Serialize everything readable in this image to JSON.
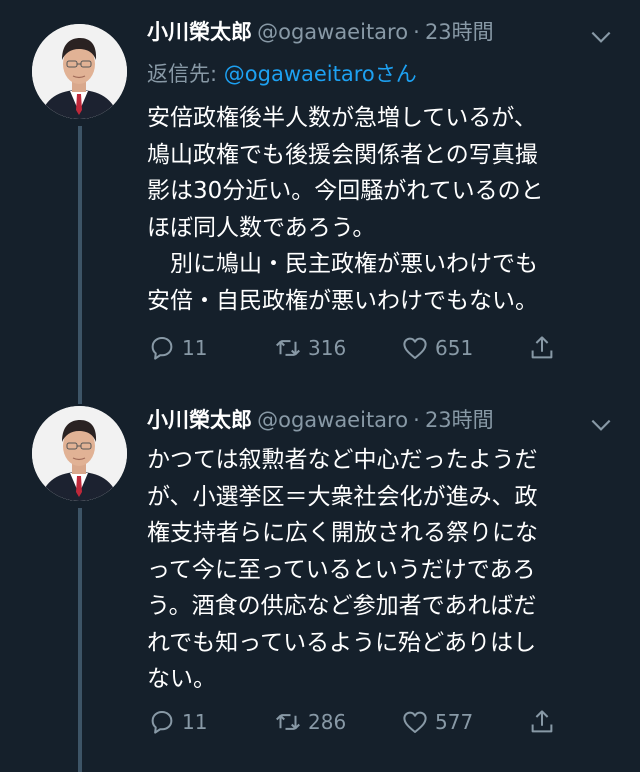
{
  "tweets": [
    {
      "author_name": "小川榮太郎",
      "handle": "@ogawaeitaro",
      "separator": "·",
      "time": "23時間",
      "reply_prefix": "返信先:",
      "reply_mention": "@ogawaeitaroさん",
      "lines": [
        "安倍政権後半人数が急増しているが、",
        "鳩山政権でも後援会関係者との写真撮",
        "影は30分近い。今回騒がれているのと",
        "ほぼ同人数であろう。",
        "　別に鳩山・民主政権が悪いわけでも",
        "安倍・自民政権が悪いわけでもない。"
      ],
      "replies": "11",
      "retweets": "316",
      "likes": "651"
    },
    {
      "author_name": "小川榮太郎",
      "handle": "@ogawaeitaro",
      "separator": "·",
      "time": "23時間",
      "lines": [
        "かつては叙勲者など中心だったようだ",
        "が、小選挙区＝大衆社会化が進み、政",
        "権支持者らに広く開放される祭りにな",
        "って今に至っているというだけであろ",
        "う。酒食の供応など参加者であればだ",
        "れでも知っているように殆どありはし",
        "ない。"
      ],
      "replies": "11",
      "retweets": "286",
      "likes": "577"
    }
  ],
  "icons": {
    "reply": "reply-icon",
    "retweet": "retweet-icon",
    "like": "heart-icon",
    "share": "share-icon",
    "menu": "chevron-down-icon"
  },
  "colors": {
    "background": "#15202b",
    "secondary_text": "#8899a6",
    "link": "#1da1f2",
    "thread_line": "#3d5466"
  }
}
